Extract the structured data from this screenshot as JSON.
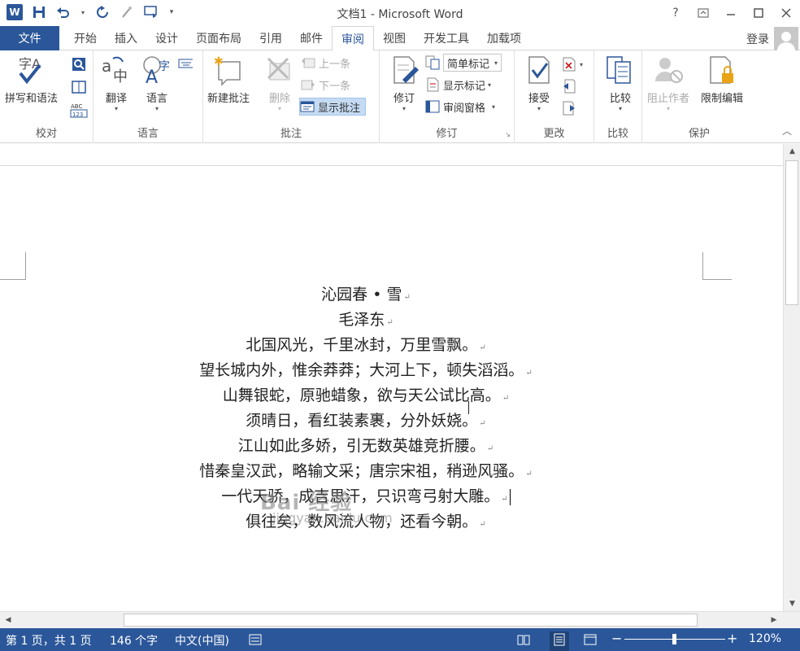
{
  "window": {
    "title": "文档1 - Microsoft Word",
    "help": "?",
    "login": "登录"
  },
  "tabs": {
    "file": "文件",
    "items": [
      "开始",
      "插入",
      "设计",
      "页面布局",
      "引用",
      "邮件",
      "审阅",
      "视图",
      "开发工具",
      "加载项"
    ],
    "active": "审阅"
  },
  "ribbon": {
    "proofing": {
      "label": "校对",
      "spelling": "拼写和语法"
    },
    "language": {
      "label": "语言",
      "translate": "翻译",
      "language": "语言"
    },
    "comments": {
      "label": "批注",
      "new": "新建批注",
      "delete": "删除",
      "previous": "上一条",
      "next": "下一条",
      "show": "显示批注"
    },
    "tracking": {
      "label": "修订",
      "track": "修订",
      "markup_mode": "简单标记",
      "show_markup": "显示标记",
      "reviewing_pane": "审阅窗格"
    },
    "changes": {
      "label": "更改",
      "accept": "接受"
    },
    "compare": {
      "label": "比较",
      "compare": "比较"
    },
    "protect": {
      "label": "保护",
      "block_authors": "阻止作者",
      "restrict_editing": "限制编辑"
    }
  },
  "document": {
    "lines": [
      "沁园春 • 雪",
      "毛泽东",
      "北国风光，千里冰封，万里雪飘。",
      "望长城内外，惟余莽莽；大河上下，顿失滔滔。",
      "山舞银蛇，原驰蜡象，欲与天公试比高。",
      "须晴日，看红装素裹，分外妖娆。",
      "江山如此多娇，引无数英雄竞折腰。",
      "惜秦皇汉武，略输文采；唐宗宋祖，稍逊风骚。",
      "一代天骄，成吉思汗，只识弯弓射大雕。",
      "俱往矣，数风流人物，还看今朝。"
    ],
    "paragraph_mark": "↵",
    "watermark": "Bai 经验",
    "watermark_url": "jingyan.baidu.com"
  },
  "status": {
    "page": "第 1 页，共 1 页",
    "words": "146 个字",
    "language": "中文(中国)",
    "zoom": "120%",
    "zoom_minus": "−",
    "zoom_plus": "+"
  },
  "colors": {
    "accent": "#2b579a",
    "selected": "#c5dbf3"
  }
}
